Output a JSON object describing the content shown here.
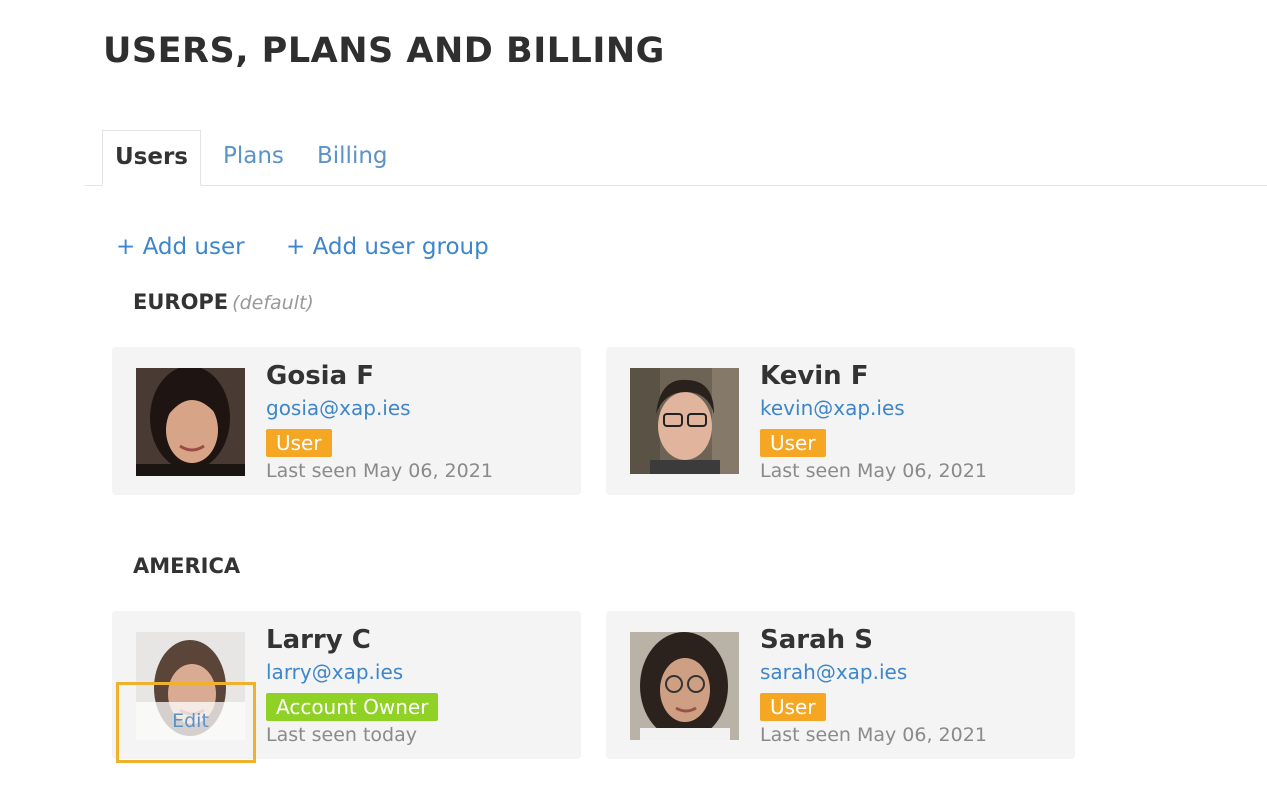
{
  "page": {
    "title": "USERS, PLANS AND BILLING"
  },
  "tabs": [
    {
      "label": "Users",
      "active": true
    },
    {
      "label": "Plans",
      "active": false
    },
    {
      "label": "Billing",
      "active": false
    }
  ],
  "actions": {
    "add_user": "+ Add user",
    "add_user_group": "+ Add user group"
  },
  "groups": [
    {
      "name": "EUROPE",
      "note": "(default)",
      "users": [
        {
          "name": "Gosia F",
          "email": "gosia@xap.ies",
          "role": "User",
          "last_seen": "Last seen May 06, 2021"
        },
        {
          "name": "Kevin F",
          "email": "kevin@xap.ies",
          "role": "User",
          "last_seen": "Last seen May 06, 2021"
        }
      ]
    },
    {
      "name": "AMERICA",
      "users": [
        {
          "name": "Larry C",
          "email": "larry@xap.ies",
          "role": "Account Owner",
          "last_seen": "Last seen today",
          "hover_action": "Edit"
        },
        {
          "name": "Sarah S",
          "email": "sarah@xap.ies",
          "role": "User",
          "last_seen": "Last seen May 06, 2021"
        }
      ]
    }
  ],
  "colors": {
    "link": "#3d86cc",
    "badge_user": "#f5a623",
    "badge_owner": "#8fd124",
    "card_bg": "#f4f4f4",
    "focus_outline": "#f0b12d"
  }
}
